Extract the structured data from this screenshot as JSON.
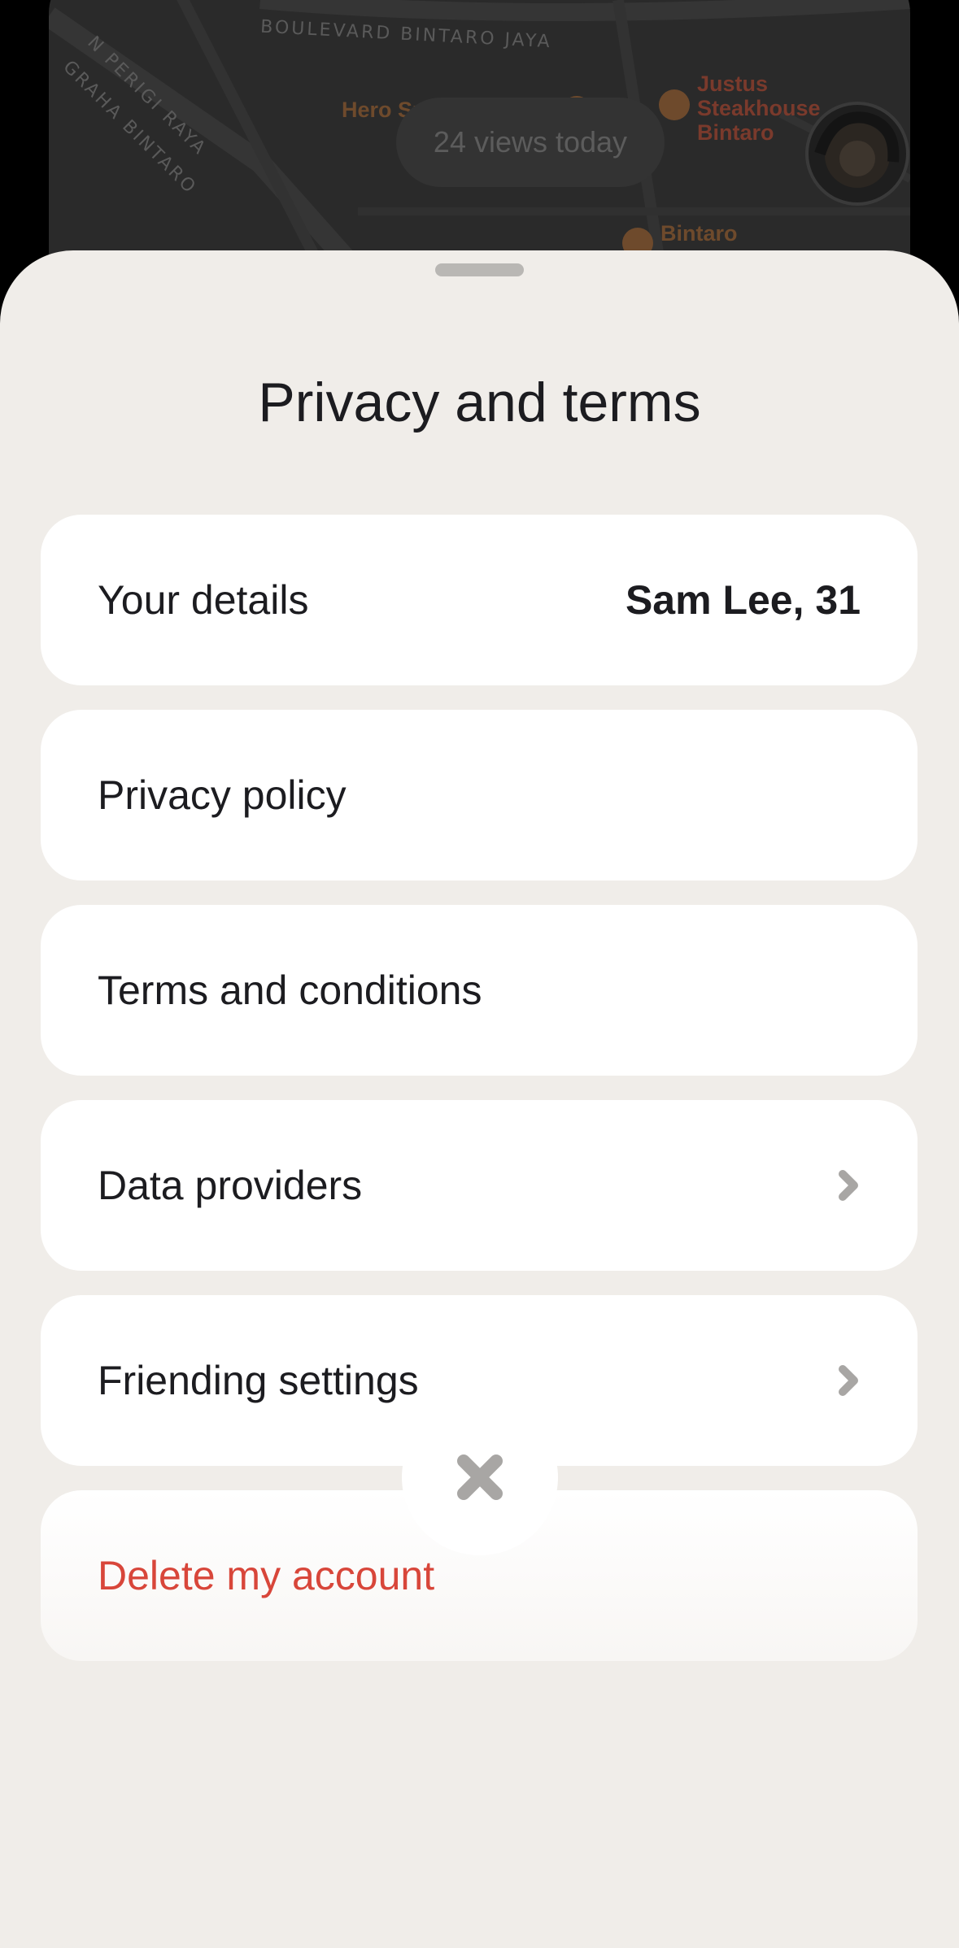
{
  "map": {
    "street_1": "BOULEVARD BINTARO JAYA",
    "street_2": "N PERIGI RAYA",
    "street_3": "GRAHA BINTARO",
    "poi_1": "Hero Supermarket",
    "poi_2_line1": "Justus",
    "poi_2_line2": "Steakhouse",
    "poi_2_line3": "Bintaro",
    "poi_3": "Bintaro",
    "views": "24 views today"
  },
  "sheet": {
    "title": "Privacy and terms",
    "rows": [
      {
        "label": "Your details",
        "value": "Sam Lee, 31"
      },
      {
        "label": "Privacy policy"
      },
      {
        "label": "Terms and conditions"
      },
      {
        "label": "Data providers"
      },
      {
        "label": "Friending settings"
      },
      {
        "label": "Delete my account"
      }
    ]
  },
  "colors": {
    "sheet_bg": "#f0ede9",
    "row_bg": "#ffffff",
    "danger": "#d8463a",
    "text": "#1c1c20",
    "chevron": "#a8a6a4"
  },
  "icons": {
    "chevron": "chevron-right-icon",
    "close": "close-icon"
  }
}
